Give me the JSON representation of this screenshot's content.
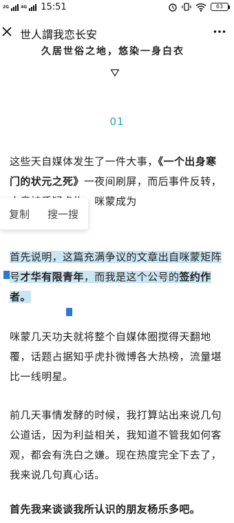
{
  "status": {
    "net1": "2G",
    "net2": "4G",
    "time": "15:51",
    "battery": "63"
  },
  "header": {
    "title": "世人謂我恋长安"
  },
  "article": {
    "top_partial": "久居世俗之地，悠染一身白衣",
    "section_number": "01",
    "p1_a": "这些天自媒体发生了一件大事，",
    "p1_bold": "《一个出身寒门的状元之死》",
    "p1_b": "一夜间刷屏，而后事件反转，文章被质疑虚构，咪蒙成为",
    "p2_a": "首先说明，这篇充满争议的文章出自咪蒙矩阵号",
    "p2_bold1": "才华有限青年",
    "p2_b": "，而我是这个公号的",
    "p2_bold2": "签约作者。",
    "p3": "咪蒙几天功夫就将整个自媒体圈搅得天翻地覆，话题占据知乎虎扑微博各大热榜，流量堪比一线明星。",
    "p4": "前几天事情发酵的时候，我打算站出来说几句公道话，因为利益相关，我知道不管我如何客观，都会有洗白之嫌。现在热度完全下去了，我来说几句真心话。",
    "p5": "首先我来谈谈我所认识的朋友杨乐多吧。"
  },
  "popup": {
    "copy": "复制",
    "search": "搜一搜"
  },
  "colors": {
    "accent": "#23a5c2",
    "selection": "#cbe6f3",
    "handle": "#2a7ad0"
  }
}
